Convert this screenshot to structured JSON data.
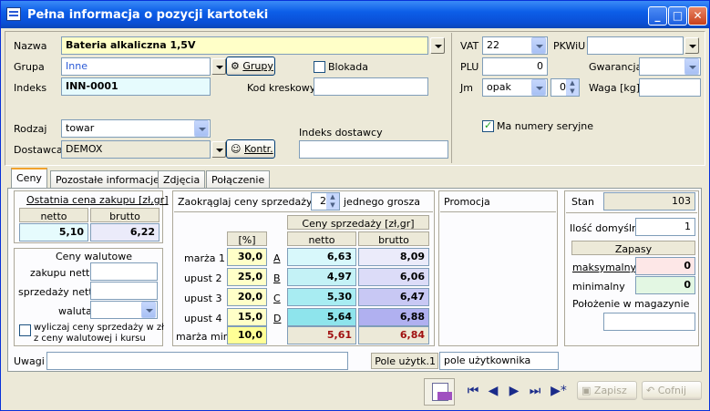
{
  "window": {
    "title": "Pełna informacja o pozycji kartoteki"
  },
  "header": {
    "nazwa_label": "Nazwa",
    "nazwa_value": "Bateria alkaliczna 1,5V",
    "grupa_label": "Grupa",
    "grupa_value": "Inne",
    "grupy_button": "Grupy",
    "blokada_label": "Blokada",
    "indeks_label": "Indeks",
    "indeks_value": "INN-0001",
    "kod_label": "Kod kreskowy",
    "kod_value": "",
    "rodzaj_label": "Rodzaj",
    "rodzaj_value": "towar",
    "dostawca_label": "Dostawca",
    "dostawca_value": "DEMOX",
    "kontr_button": "Kontr.",
    "indeks_dostawcy_label": "Indeks dostawcy",
    "indeks_dostawcy_value": "",
    "vat_label": "VAT",
    "vat_value": "22",
    "pkwiu_label": "PKWiU",
    "pkwiu_value": "",
    "plu_label": "PLU",
    "plu_value": "0",
    "gwarancja_label": "Gwarancja",
    "gwarancja_value": "",
    "jm_label": "Jm",
    "jm_value": "opak",
    "jm_num": "0",
    "waga_label": "Waga [kg]",
    "waga_value": "",
    "serial_label": "Ma numery seryjne",
    "serial_checked": true
  },
  "tabs": [
    {
      "label": "Ceny"
    },
    {
      "label": "Pozostałe informacje"
    },
    {
      "label": "Zdjęcia"
    },
    {
      "label": "Połączenie"
    }
  ],
  "ceny": {
    "ostatnia_title": "Ostatnia cena zakupu [zł,gr]",
    "netto_label": "netto",
    "brutto_label": "brutto",
    "ostatnia_netto": "5,10",
    "ostatnia_brutto": "6,22",
    "walutowe_title": "Ceny walutowe",
    "zakupu_netto_label": "zakupu netto",
    "sprzedazy_netto_label": "sprzedaży netto",
    "waluta_label": "waluta",
    "wyliczaj_label_1": "wyliczaj ceny sprzedaży w zł",
    "wyliczaj_label_2": "z ceny walutowej i kursu",
    "zaokraglaj_label": "Zaokrąglaj ceny sprzedaży do",
    "zaokraglaj_value": "2",
    "grosza_label": "jednego grosza",
    "pct_header": "[%]",
    "sprzedazy_header": "Ceny sprzedaży [zł,gr]",
    "netto_header": "netto",
    "brutto_header": "brutto",
    "rows": [
      {
        "label": "marża 1",
        "pct": "30,0",
        "letter": "A",
        "netto": "6,63",
        "brutto": "8,09"
      },
      {
        "label": "upust 2",
        "pct": "25,0",
        "letter": "B",
        "netto": "4,97",
        "brutto": "6,06"
      },
      {
        "label": "upust 3",
        "pct": "20,0",
        "letter": "C",
        "netto": "5,30",
        "brutto": "6,47"
      },
      {
        "label": "upust 4",
        "pct": "15,0",
        "letter": "D",
        "netto": "5,64",
        "brutto": "6,88"
      }
    ],
    "marza_min_label": "marża min.",
    "marza_min_pct": "10,0",
    "marza_min_netto": "5,61",
    "marza_min_brutto": "6,84",
    "promocja_label": "Promocja",
    "stan_label": "Stan",
    "stan_value": "103",
    "ilosc_label": "Ilość domyślna",
    "ilosc_value": "1",
    "zapasy_label": "Zapasy",
    "maks_label": "maksymalny",
    "maks_value": "0",
    "min_label": "minimalny",
    "min_value": "0",
    "polozenie_label": "Położenie w magazynie",
    "polozenie_value": ""
  },
  "footer": {
    "uwagi_label": "Uwagi",
    "uwagi_value": "",
    "pole_label": "Pole użytk.1",
    "pole_value": "pole użytkownika",
    "zapisz_button": "Zapisz",
    "cofnij_button": "Cofnij"
  },
  "colors": {
    "title_bar": "#0a4fd6",
    "yellow_field": "#ffffc8",
    "cyan_field": "#e6fbfd"
  }
}
